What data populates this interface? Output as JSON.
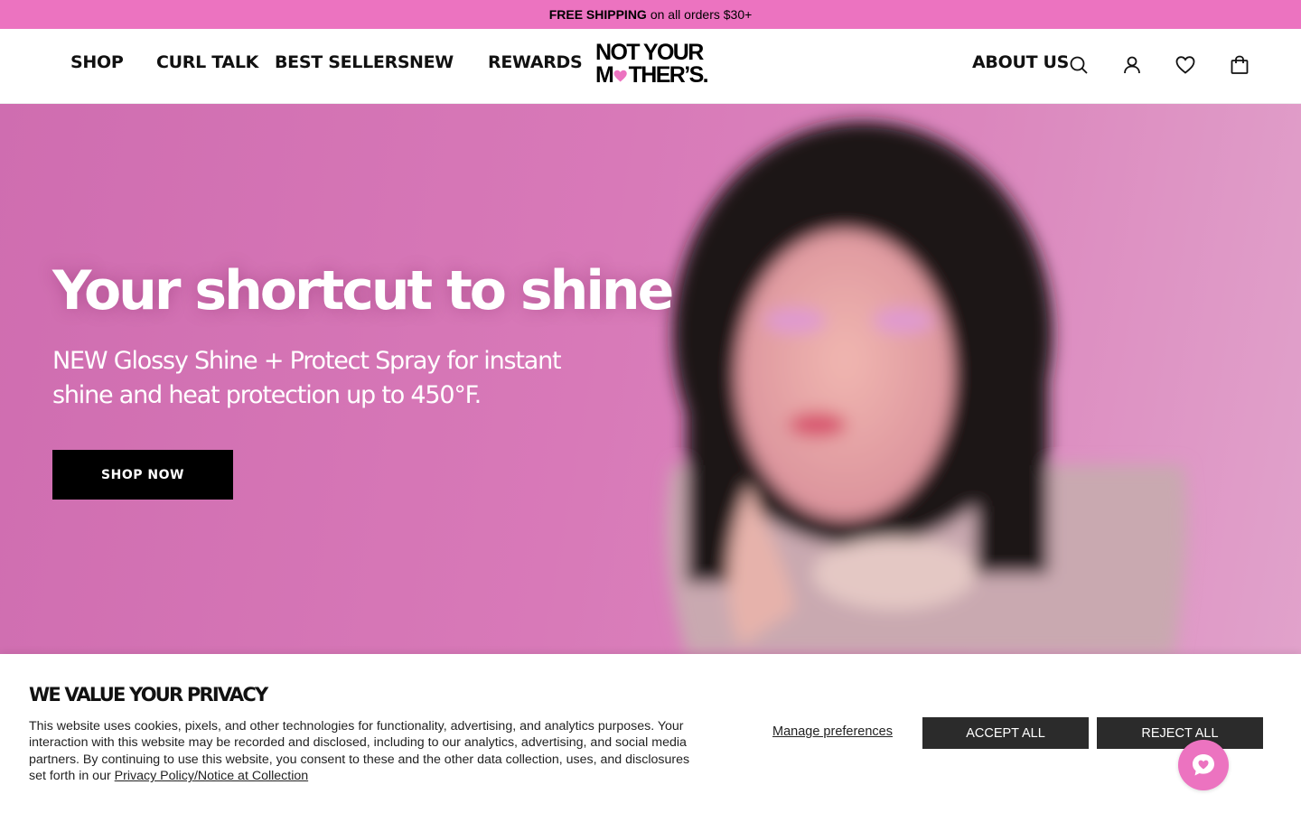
{
  "announcement": {
    "bold": "FREE SHIPPING",
    "rest": "on all orders $30+"
  },
  "header": {
    "nav_left": [
      "SHOP",
      "CURL TALK",
      "BEST SELLERS",
      "NEW",
      "REWARDS"
    ],
    "logo_line1": "NOT YOUR",
    "logo_line2_a": "M",
    "logo_line2_b": "THER’S",
    "logo_line2_c": ".",
    "nav_right": "ABOUT US",
    "icons": [
      "search-icon",
      "account-icon",
      "wishlist-heart-icon",
      "cart-bag-icon"
    ]
  },
  "hero": {
    "title": "Your shortcut to shine",
    "subtitle": "NEW Glossy Shine + Protect Spray for instant shine and heat protection up to 450°F.",
    "cta": "SHOP NOW"
  },
  "privacy": {
    "title": "WE VALUE YOUR PRIVACY",
    "text": "This website uses cookies, pixels, and other technologies for functionality, advertising, and analytics purposes. Your interaction with this website may be recorded and disclosed, including to our analytics, advertising, and social media partners. By continuing to use this website, you consent to these and the other data collection, uses, and disclosures set forth in our",
    "link": "Privacy Policy/Notice at Collection",
    "manage": "Manage preferences",
    "accept": "ACCEPT ALL",
    "reject": "REJECT ALL"
  },
  "colors": {
    "brand_pink": "#ec73c0",
    "hero_pink": "#d879b8",
    "dark_button": "#2b2b2b"
  }
}
